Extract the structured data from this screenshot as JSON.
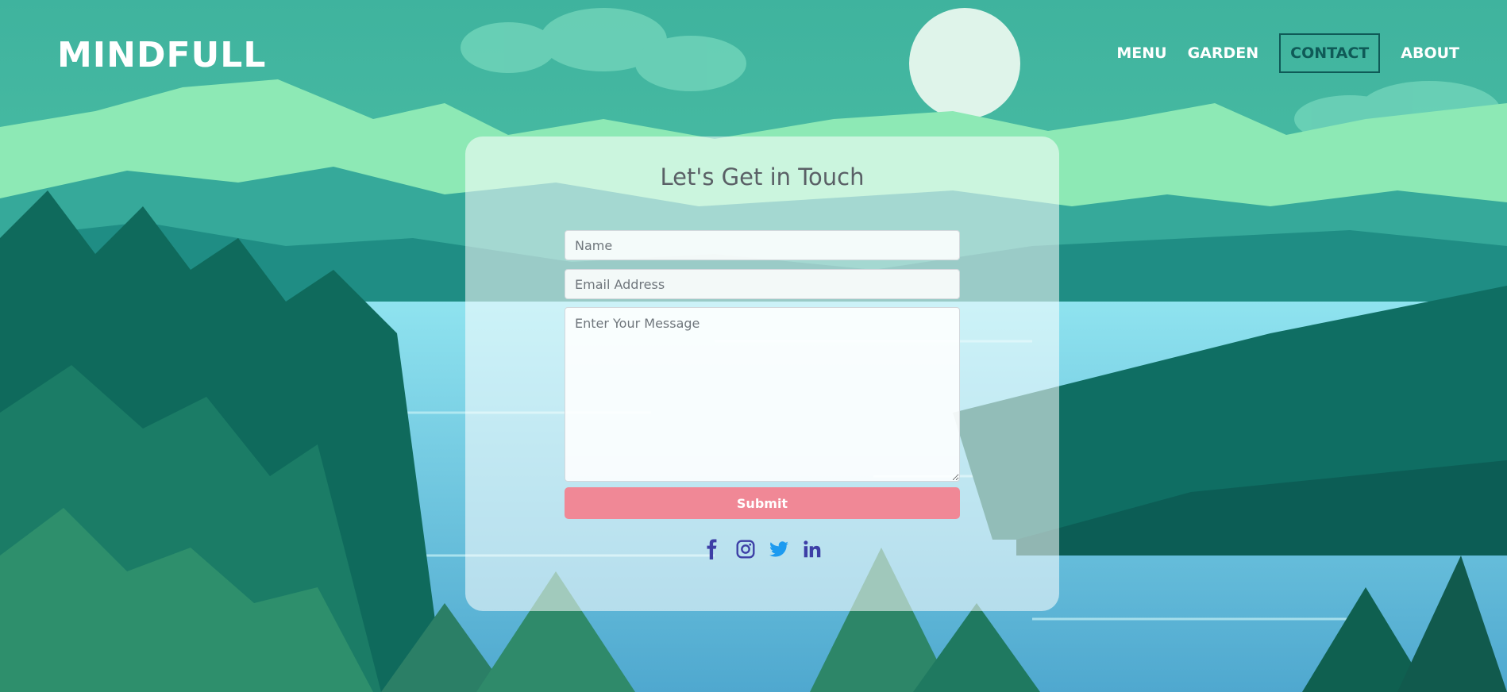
{
  "header": {
    "logo": "MINDFULL",
    "nav": [
      {
        "label": "MENU"
      },
      {
        "label": "GARDEN"
      },
      {
        "label": "CONTACT",
        "active": true
      },
      {
        "label": "ABOUT"
      }
    ]
  },
  "contact_form": {
    "title": "Let's Get in Touch",
    "name_placeholder": "Name",
    "email_placeholder": "Email Address",
    "message_placeholder": "Enter Your Message",
    "submit_label": "Submit"
  },
  "socials": [
    {
      "icon": "facebook-icon"
    },
    {
      "icon": "instagram-icon"
    },
    {
      "icon": "twitter-icon"
    },
    {
      "icon": "linkedin-icon"
    }
  ],
  "colors": {
    "accent": "#f08896",
    "nav_active": "#0f5a57",
    "social_icon": "#3d3fa6"
  }
}
